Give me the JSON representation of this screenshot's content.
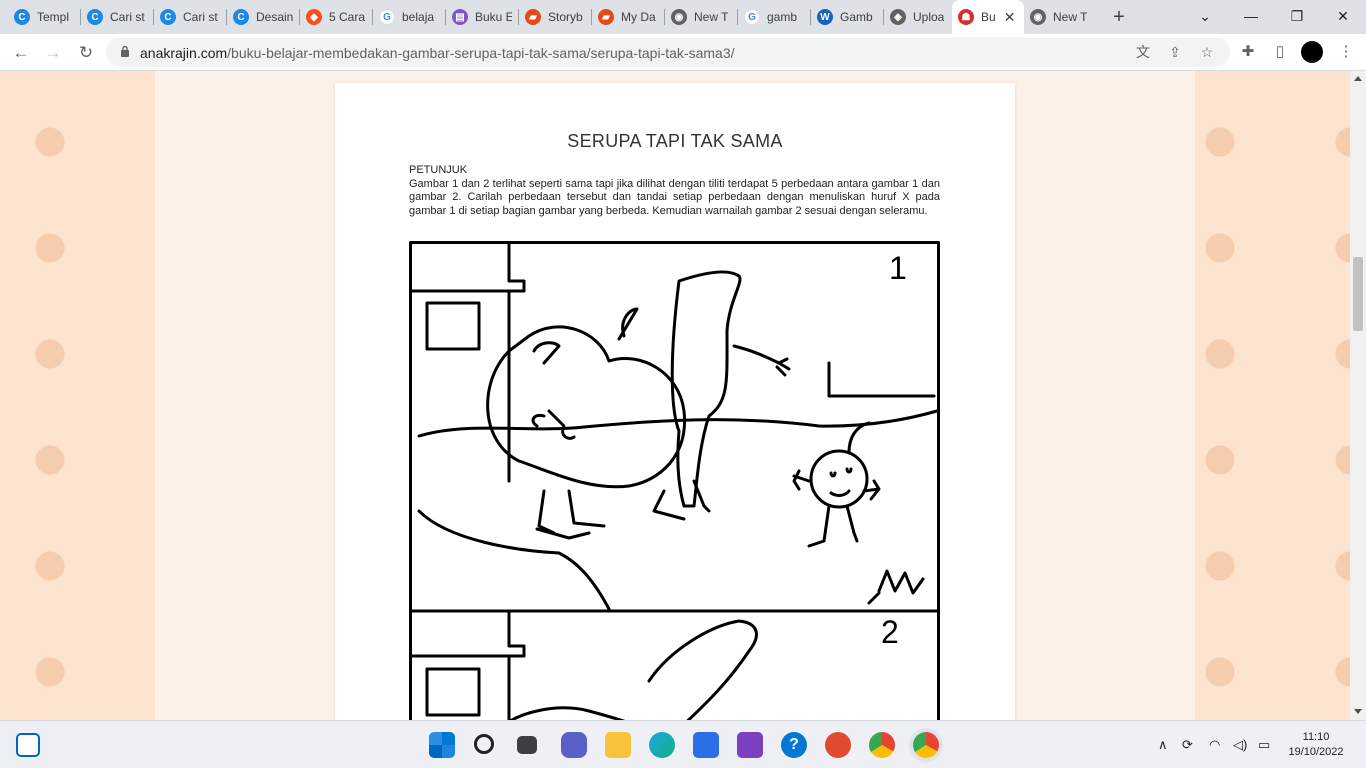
{
  "browser": {
    "tabs": [
      {
        "label": "Templ",
        "icon": "canva-icon"
      },
      {
        "label": "Cari st",
        "icon": "canva-icon"
      },
      {
        "label": "Cari st",
        "icon": "canva-icon"
      },
      {
        "label": "Desain",
        "icon": "canva-icon"
      },
      {
        "label": "5 Cara",
        "icon": "nbc-icon"
      },
      {
        "label": "belaja",
        "icon": "google-icon"
      },
      {
        "label": "Buku E",
        "icon": "book-icon"
      },
      {
        "label": "Storyb",
        "icon": "chat-icon"
      },
      {
        "label": "My Da",
        "icon": "chat-icon"
      },
      {
        "label": "New T",
        "icon": "chrome-icon"
      },
      {
        "label": "gamb",
        "icon": "google-icon"
      },
      {
        "label": "Gamb",
        "icon": "w-icon"
      },
      {
        "label": "Uploa",
        "icon": "stack-icon"
      },
      {
        "label": "Bu",
        "icon": "anakrajin-icon",
        "active": true
      },
      {
        "label": "New T",
        "icon": "chrome-icon"
      }
    ],
    "url_host": "anakrajin.com",
    "url_path": "/buku-belajar-membedakan-gambar-serupa-tapi-tak-sama/serupa-tapi-tak-sama3/"
  },
  "worksheet": {
    "title": "SERUPA TAPI TAK SAMA",
    "heading": "PETUNJUK",
    "instruction": "Gambar 1 dan 2 terlihat  seperti sama tapi jika dilihat dengan tiliti  terdapat 5 perbedaan antara gambar 1 dan gambar 2. Carilah perbedaan tersebut dan tandai setiap perbedaan dengan menuliskan huruf X pada gambar 1 di setiap bagian gambar yang berbeda. Kemudian warnailah gambar 2 sesuai dengan seleramu.",
    "panel_1_number": "1",
    "panel_2_number": "2"
  },
  "taskbar": {
    "time": "11:10",
    "date": "19/10/2022"
  },
  "colors": {
    "page_background": "#fde4cf",
    "accent": "#1a73e8"
  }
}
